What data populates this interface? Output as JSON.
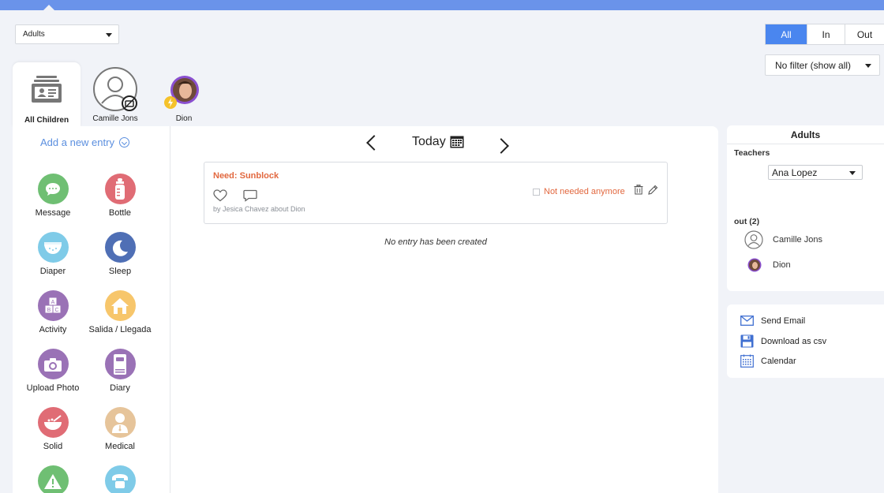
{
  "header": {
    "group_select": "Adults",
    "filter_tabs": [
      "All",
      "In",
      "Out"
    ],
    "active_filter": "All",
    "status_filter": "No filter (show all)"
  },
  "children_tabs": [
    {
      "label": "All Children",
      "active": true
    },
    {
      "label": "Camille Jons",
      "active": false
    },
    {
      "label": "Dion",
      "active": false
    }
  ],
  "left": {
    "add_entry": "Add a new entry",
    "entries": [
      {
        "label": "Message",
        "color": "#6fbf73",
        "icon": "message-icon"
      },
      {
        "label": "Bottle",
        "color": "#e06c75",
        "icon": "bottle-icon"
      },
      {
        "label": "Diaper",
        "color": "#7fcbe8",
        "icon": "diaper-icon"
      },
      {
        "label": "Sleep",
        "color": "#4f6fb5",
        "icon": "sleep-icon"
      },
      {
        "label": "Activity",
        "color": "#9a72b6",
        "icon": "activity-icon"
      },
      {
        "label": "Salida / Llegada",
        "color": "#f7c66b",
        "icon": "home-icon"
      },
      {
        "label": "Upload Photo",
        "color": "#9a72b6",
        "icon": "camera-icon"
      },
      {
        "label": "Diary",
        "color": "#9a72b6",
        "icon": "diary-icon"
      },
      {
        "label": "Solid",
        "color": "#e06c75",
        "icon": "solid-food-icon"
      },
      {
        "label": "Medical",
        "color": "#e6c49a",
        "icon": "medical-icon"
      },
      {
        "label": "",
        "color": "#6fbf73",
        "icon": "warning-icon"
      },
      {
        "label": "",
        "color": "#7fcbe8",
        "icon": "phone-icon"
      }
    ]
  },
  "center": {
    "date_label": "Today",
    "card": {
      "title": "Need: Sunblock",
      "by": "by Jesica Chavez about Dion",
      "not_needed": "Not needed anymore"
    },
    "empty_message": "No entry has been created"
  },
  "side": {
    "title": "Adults",
    "teachers_label": "Teachers",
    "teacher_select": "Ana Lopez",
    "out_label": "out (2)",
    "people": [
      "Camille Jons",
      "Dion"
    ],
    "actions": [
      "Send Email",
      "Download as csv",
      "Calendar"
    ]
  },
  "colors": {
    "accent": "#4a86ef",
    "topbar": "#6a93ea",
    "alert": "#e2683f",
    "link": "#5b8fdf"
  }
}
